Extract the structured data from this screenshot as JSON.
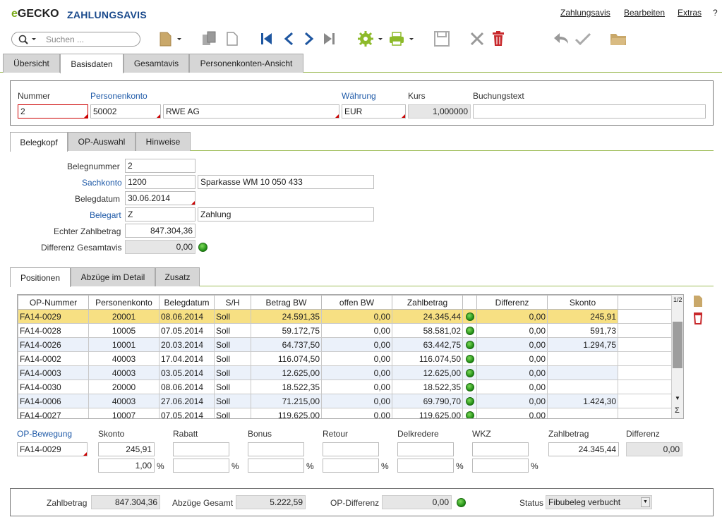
{
  "app": {
    "logo_prefix": "e",
    "logo_rest": "GECKO",
    "title": "ZAHLUNGSAVIS"
  },
  "menu": [
    {
      "label": "Zahlungsavis"
    },
    {
      "label": "Bearbeiten"
    },
    {
      "label": "Extras"
    },
    {
      "label": "?"
    }
  ],
  "search": {
    "placeholder": "Suchen ..."
  },
  "main_tabs": [
    {
      "label": "Übersicht"
    },
    {
      "label": "Basisdaten"
    },
    {
      "label": "Gesamtavis"
    },
    {
      "label": "Personenkonten-Ansicht"
    }
  ],
  "header": {
    "nummer_label": "Nummer",
    "nummer": "2",
    "personenkonto_label": "Personenkonto",
    "personenkonto": "50002",
    "personenkonto_name": "RWE AG",
    "waehrung_label": "Währung",
    "waehrung": "EUR",
    "kurs_label": "Kurs",
    "kurs": "1,000000",
    "buchungstext_label": "Buchungstext",
    "buchungstext": ""
  },
  "sub_tabs": [
    {
      "label": "Belegkopf"
    },
    {
      "label": "OP-Auswahl"
    },
    {
      "label": "Hinweise"
    }
  ],
  "belegkopf": {
    "belegnummer_label": "Belegnummer",
    "belegnummer": "2",
    "sachkonto_label": "Sachkonto",
    "sachkonto": "1200",
    "sachkonto_name": "Sparkasse WM 10 050 433",
    "belegdatum_label": "Belegdatum",
    "belegdatum": "30.06.2014",
    "belegart_label": "Belegart",
    "belegart": "Z",
    "belegart_name": "Zahlung",
    "zahlbetrag_label": "Echter Zahlbetrag",
    "zahlbetrag": "847.304,36",
    "differenz_label": "Differenz Gesamtavis",
    "differenz": "0,00"
  },
  "pos_tabs": [
    {
      "label": "Positionen"
    },
    {
      "label": "Abzüge im Detail"
    },
    {
      "label": "Zusatz"
    }
  ],
  "table": {
    "columns": [
      "OP-Nummer",
      "Personenkonto",
      "Belegdatum",
      "S/H",
      "Betrag BW",
      "offen BW",
      "Zahlbetrag",
      "",
      "Differenz",
      "Skonto"
    ],
    "page_indicator": "1/2",
    "sum_symbol": "Σ",
    "rows": [
      {
        "op": "FA14-0029",
        "pk": "20001",
        "datum": "08.06.2014",
        "sh": "Soll",
        "betrag": "24.591,35",
        "offen": "0,00",
        "zahl": "24.345,44",
        "diff": "0,00",
        "skonto": "245,91"
      },
      {
        "op": "FA14-0028",
        "pk": "10005",
        "datum": "07.05.2014",
        "sh": "Soll",
        "betrag": "59.172,75",
        "offen": "0,00",
        "zahl": "58.581,02",
        "diff": "0,00",
        "skonto": "591,73"
      },
      {
        "op": "FA14-0026",
        "pk": "10001",
        "datum": "20.03.2014",
        "sh": "Soll",
        "betrag": "64.737,50",
        "offen": "0,00",
        "zahl": "63.442,75",
        "diff": "0,00",
        "skonto": "1.294,75"
      },
      {
        "op": "FA14-0002",
        "pk": "40003",
        "datum": "17.04.2014",
        "sh": "Soll",
        "betrag": "116.074,50",
        "offen": "0,00",
        "zahl": "116.074,50",
        "diff": "0,00",
        "skonto": ""
      },
      {
        "op": "FA14-0003",
        "pk": "40003",
        "datum": "03.05.2014",
        "sh": "Soll",
        "betrag": "12.625,00",
        "offen": "0,00",
        "zahl": "12.625,00",
        "diff": "0,00",
        "skonto": ""
      },
      {
        "op": "FA14-0030",
        "pk": "20000",
        "datum": "08.06.2014",
        "sh": "Soll",
        "betrag": "18.522,35",
        "offen": "0,00",
        "zahl": "18.522,35",
        "diff": "0,00",
        "skonto": ""
      },
      {
        "op": "FA14-0006",
        "pk": "40003",
        "datum": "27.06.2014",
        "sh": "Soll",
        "betrag": "71.215,00",
        "offen": "0,00",
        "zahl": "69.790,70",
        "diff": "0,00",
        "skonto": "1.424,30"
      },
      {
        "op": "FA14-0027",
        "pk": "10007",
        "datum": "07.05.2014",
        "sh": "Soll",
        "betrag": "119.625,00",
        "offen": "0,00",
        "zahl": "119.625,00",
        "diff": "0,00",
        "skonto": ""
      }
    ]
  },
  "detail": {
    "op_label": "OP-Bewegung",
    "op": "FA14-0029",
    "skonto_label": "Skonto",
    "skonto": "245,91",
    "skonto_pct": "1,00",
    "rabatt_label": "Rabatt",
    "bonus_label": "Bonus",
    "retour_label": "Retour",
    "delkredere_label": "Delkredere",
    "wkz_label": "WKZ",
    "zahlbetrag_label": "Zahlbetrag",
    "zahlbetrag": "24.345,44",
    "differenz_label": "Differenz",
    "differenz": "0,00",
    "pct_symbol": "%"
  },
  "footer": {
    "zahlbetrag_label": "Zahlbetrag",
    "zahlbetrag": "847.304,36",
    "abzuege_label": "Abzüge Gesamt",
    "abzuege": "5.222,59",
    "opdiff_label": "OP-Differenz",
    "opdiff": "0,00",
    "status_label": "Status",
    "status": "Fibubeleg verbucht"
  },
  "colors": {
    "accent": "#7aaa19",
    "title": "#1a4a8c",
    "selected_row": "#f7e083",
    "status_ok": "#2fa81c"
  }
}
